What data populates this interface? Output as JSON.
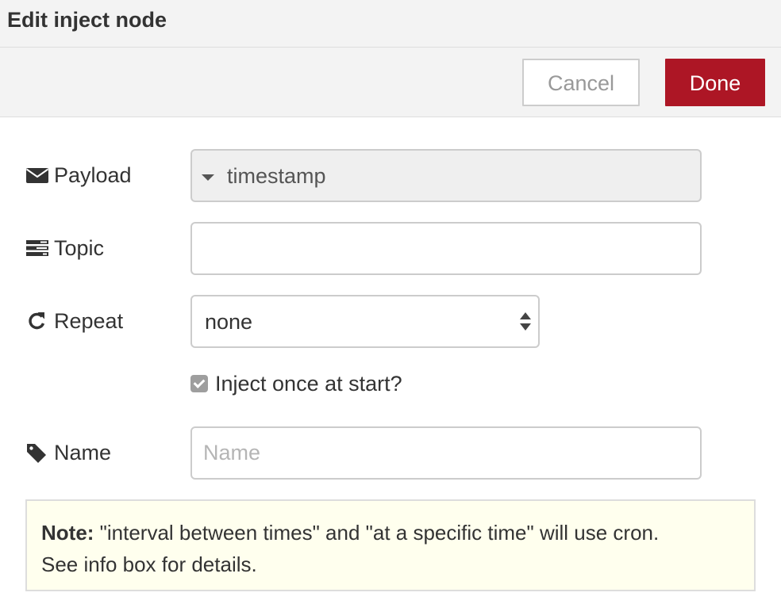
{
  "dialog": {
    "title": "Edit inject node"
  },
  "buttons": {
    "cancel_label": "Cancel",
    "done_label": "Done"
  },
  "form": {
    "payload": {
      "label": "Payload",
      "icon": "envelope-icon",
      "value": "timestamp"
    },
    "topic": {
      "label": "Topic",
      "icon": "tasks-icon",
      "value": ""
    },
    "repeat": {
      "label": "Repeat",
      "icon": "repeat-icon",
      "value": "none"
    },
    "inject_once": {
      "label": "Inject once at start?",
      "checked": true
    },
    "name": {
      "label": "Name",
      "icon": "tag-icon",
      "value": "",
      "placeholder": "Name"
    }
  },
  "note": {
    "prefix": "Note:",
    "text": " \"interval between times\" and \"at a specific time\" will use cron.",
    "text2": "See info box for details."
  },
  "colors": {
    "accent": "#ad1625",
    "tray_bg": "#f3f3f3",
    "note_bg": "#ffffee",
    "checkbox": "#9e9e9e"
  }
}
